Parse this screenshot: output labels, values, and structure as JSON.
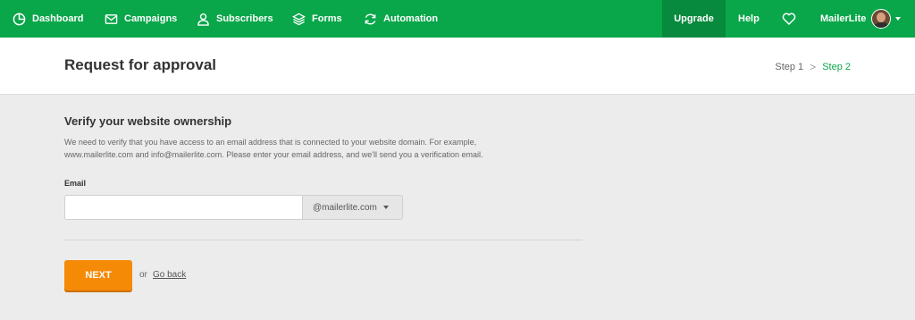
{
  "nav": {
    "items": [
      {
        "label": "Dashboard",
        "icon": "dashboard-icon"
      },
      {
        "label": "Campaigns",
        "icon": "envelope-icon"
      },
      {
        "label": "Subscribers",
        "icon": "user-icon"
      },
      {
        "label": "Forms",
        "icon": "layers-icon"
      },
      {
        "label": "Automation",
        "icon": "refresh-icon"
      }
    ],
    "upgrade_label": "Upgrade",
    "help_label": "Help",
    "account_name": "MailerLite"
  },
  "header": {
    "title": "Request for approval",
    "step1": "Step 1",
    "step_separator": ">",
    "step2": "Step 2"
  },
  "form": {
    "section_title": "Verify your website ownership",
    "description_line1": "We need to verify that you have access to an email address that is connected to your website domain. For example,",
    "description_line2": "www.mailerlite.com and info@mailerlite.com. Please enter your email address, and we'll send you a verification email.",
    "email_label": "Email",
    "email_value": "",
    "domain_selected": "@mailerlite.com",
    "next_label": "NEXT",
    "or_text": "or",
    "go_back_label": "Go back"
  },
  "colors": {
    "brand_green": "#09a64a",
    "upgrade_bg": "#078a3d",
    "next_orange": "#f58a07"
  }
}
